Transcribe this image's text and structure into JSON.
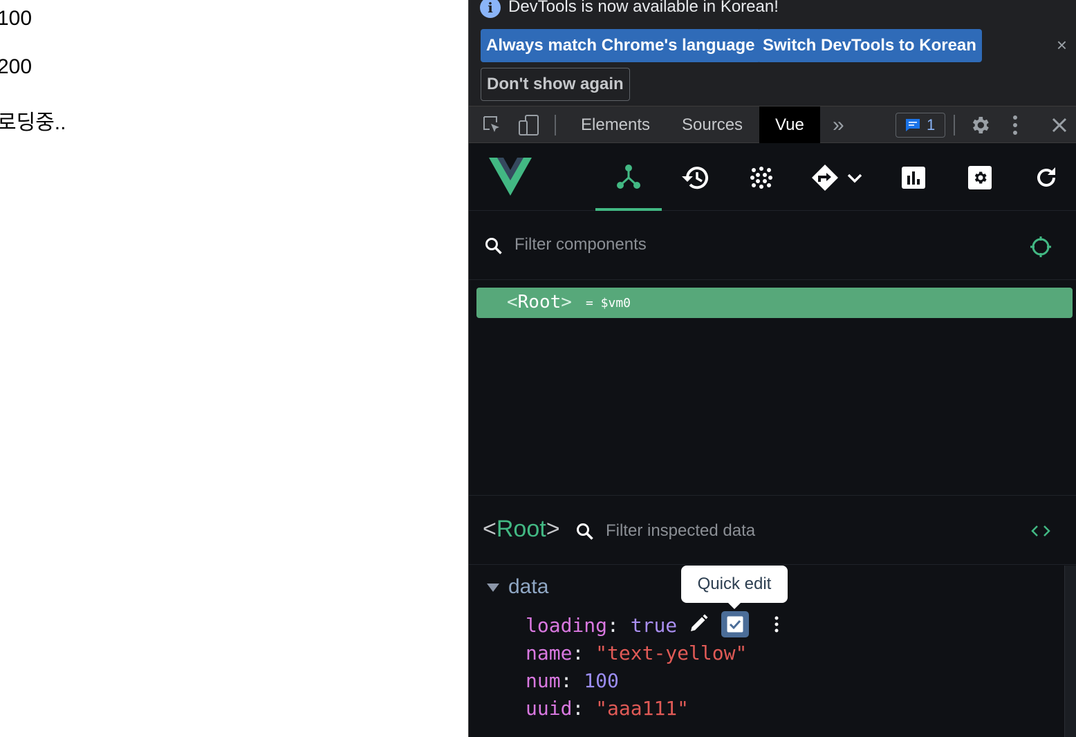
{
  "page": {
    "lines": [
      "100",
      "200",
      "로딩중.."
    ]
  },
  "infobar": {
    "message": "DevTools is now available in Korean!",
    "btn_match": "Always match Chrome's language",
    "btn_switch": "Switch DevTools to Korean",
    "btn_dont_show": "Don't show again",
    "close": "×"
  },
  "toolbar": {
    "tabs": [
      {
        "label": "Elements"
      },
      {
        "label": "Sources"
      },
      {
        "label": "Vue",
        "active": true
      }
    ],
    "more": "»",
    "issues_count": "1"
  },
  "vue": {
    "tabs": [
      "components",
      "timeline",
      "pinia",
      "routes",
      "performance",
      "settings",
      "refresh"
    ],
    "filter_placeholder": "Filter components",
    "tree": {
      "open": "<",
      "name": "Root",
      "close": ">",
      "eq": "= $vm0"
    },
    "inspector": {
      "open": "<",
      "name": "Root",
      "close": ">",
      "filter_placeholder": "Filter inspected data"
    },
    "state": {
      "section": "data",
      "tooltip": "Quick edit",
      "props": [
        {
          "key": "loading",
          "value": "true"
        },
        {
          "key": "name",
          "value": "\"text-yellow\""
        },
        {
          "key": "num",
          "value": "100"
        },
        {
          "key": "uuid",
          "value": "\"aaa111\""
        }
      ]
    }
  },
  "colors": {
    "vue_green": "#42b883",
    "row_green": "#57a87a",
    "key_purple": "#d978e0",
    "string_red": "#e05a56",
    "accent_blue": "#2f6bb8"
  }
}
